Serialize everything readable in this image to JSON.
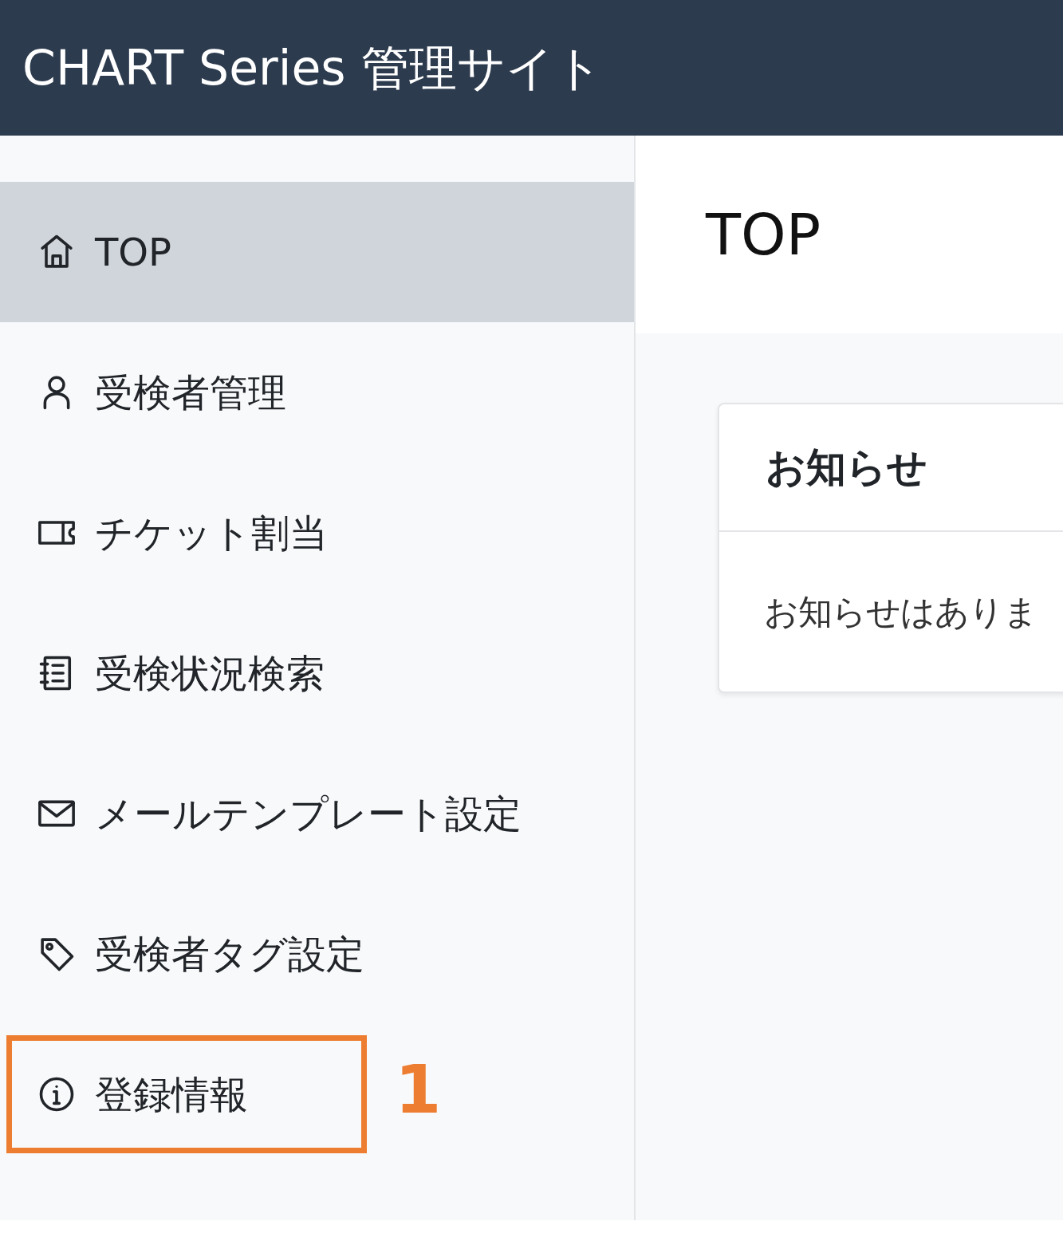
{
  "header": {
    "title": "CHART Series 管理サイト"
  },
  "sidebar": {
    "items": [
      {
        "kind": "home",
        "label": "TOP",
        "selected": true,
        "annotated": false
      },
      {
        "kind": "person",
        "label": "受検者管理",
        "selected": false,
        "annotated": false
      },
      {
        "kind": "ticket",
        "label": "チケット割当",
        "selected": false,
        "annotated": false
      },
      {
        "kind": "notebook",
        "label": "受検状況検索",
        "selected": false,
        "annotated": false
      },
      {
        "kind": "envelope",
        "label": "メールテンプレート設定",
        "selected": false,
        "annotated": false
      },
      {
        "kind": "tag",
        "label": "受検者タグ設定",
        "selected": false,
        "annotated": false
      },
      {
        "kind": "info",
        "label": "登録情報",
        "selected": false,
        "annotated": true,
        "annotation": "1"
      }
    ]
  },
  "page": {
    "title": "TOP"
  },
  "card": {
    "title": "お知らせ",
    "body": "お知らせはありま"
  }
}
